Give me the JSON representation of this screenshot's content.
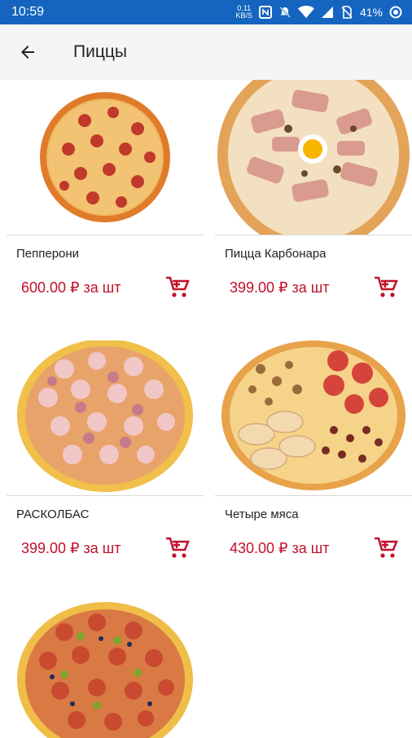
{
  "status_bar": {
    "time": "10:59",
    "net_speed_value": "0.11",
    "net_speed_unit": "KB/S",
    "battery": "41%"
  },
  "app_bar": {
    "title": "Пиццы",
    "back_icon": "arrow-left-icon"
  },
  "products": [
    {
      "name": "Пепперони",
      "price": "600.00 ₽ за шт",
      "image": "pepperoni-pizza"
    },
    {
      "name": "Пицца Карбонара",
      "price": "399.00 ₽ за шт",
      "image": "carbonara-pizza"
    },
    {
      "name": "РАСКОЛБАС",
      "price": "399.00 ₽ за шт",
      "image": "raskolbas-pizza"
    },
    {
      "name": "Четыре мяса",
      "price": "430.00 ₽ за шт",
      "image": "four-meats-pizza"
    },
    {
      "name": "",
      "price": "",
      "image": "olive-pepperoni-pizza"
    }
  ],
  "colors": {
    "status_bar": "#1565c0",
    "price": "#c0102a",
    "cart_icon": "#c0102a"
  }
}
